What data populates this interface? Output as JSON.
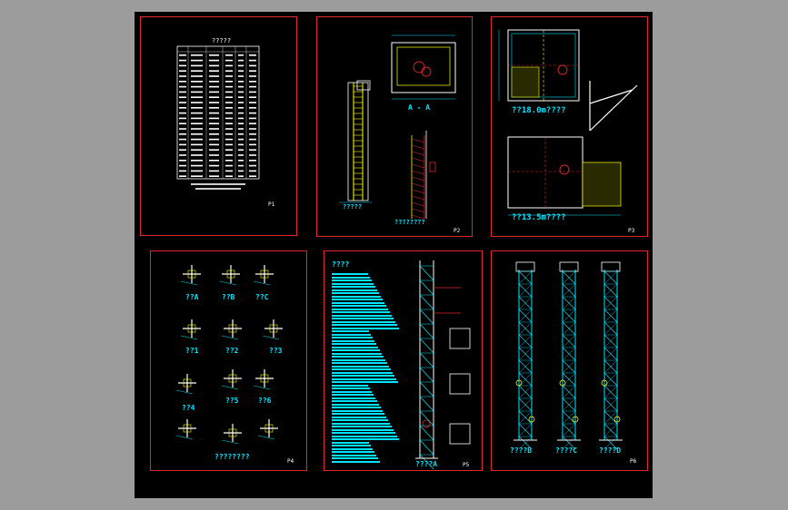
{
  "sheets": {
    "p1": {
      "table_title": "?????",
      "sheet_no": "P1"
    },
    "p2": {
      "section_label": "A - A",
      "elevation_title": "?????",
      "ladder_title": "????????",
      "sheet_no": "P2"
    },
    "p3": {
      "top_plan_title": "??18.0m????",
      "bottom_plan_title": "??13.5m????",
      "sheet_no": "P3"
    },
    "p4": {
      "details": [
        "??A",
        "??B",
        "??C",
        "??1",
        "??2",
        "??3",
        "??4",
        "??5",
        "??6"
      ],
      "bottom_title": "????????",
      "sheet_no": "P4"
    },
    "p5": {
      "notes_title": "????",
      "elevation_title": "????A",
      "sheet_no": "P5"
    },
    "p6": {
      "elevations": [
        "????B",
        "????C",
        "????D"
      ],
      "sheet_no": "P6"
    }
  },
  "colors": {
    "background": "#000000",
    "frame": "#e0282a",
    "cyan": "#00e5ff",
    "yellow": "#ffff00",
    "white": "#ffffff",
    "outer": "#9c9c9c"
  }
}
